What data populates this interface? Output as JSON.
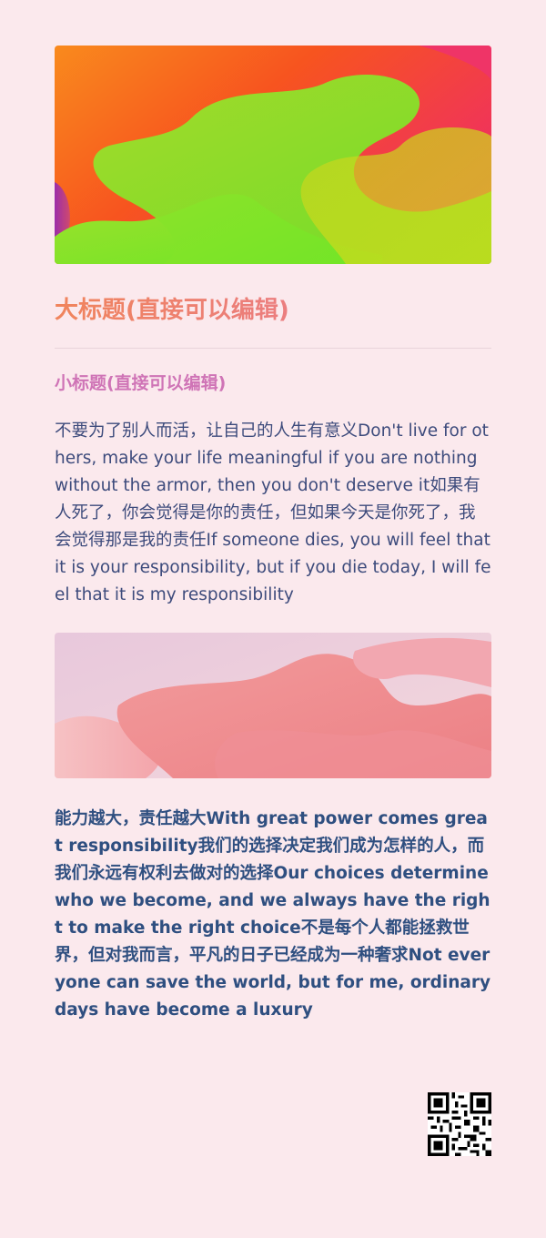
{
  "article": {
    "title": "大标题(直接可以编辑)",
    "subtitle": "小标题(直接可以编辑)",
    "paragraph1": "不要为了别人而活，让自己的人生有意义Don't live for others, make your life meaningful if you are nothing without the armor, then you don't deserve it如果有人死了，你会觉得是你的责任，但如果今天是你死了，我会觉得那是我的责任If someone dies, you will feel that it is your responsibility, but if you die today, I will feel that it is my responsibility",
    "paragraph2": "能力越大，责任越大With great power comes great responsibility我们的选择决定我们成为怎样的人，而我们永远有权利去做对的选择Our choices determine who we become, and we always have the right to make the right choice不是每个人都能拯救世界，但对我而言，平凡的日子已经成为一种奢求Not everyone can save the world, but for me, ordinary days have become a luxury"
  },
  "colors": {
    "background": "#fbe9ed",
    "title_gradient_start": "#f0845c",
    "title_gradient_end": "#e7789e",
    "subtitle": "#cf74b6",
    "body_text": "#3d4b7c"
  },
  "images": {
    "hero": "abstract-gradient-blobs-orange-green-pink",
    "secondary": "abstract-gradient-blobs-pink-coral"
  },
  "qr_code": "qr-code-icon"
}
